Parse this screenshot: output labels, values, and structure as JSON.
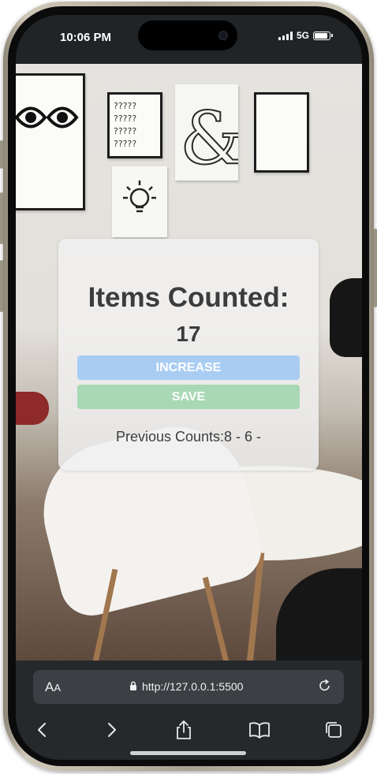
{
  "status_bar": {
    "time": "10:06 PM",
    "network": "5G"
  },
  "app": {
    "title": "Items Counted:",
    "count": "17",
    "increase_label": "INCREASE",
    "save_label": "SAVE",
    "previous_counts": "Previous Counts:8 - 6 -"
  },
  "browser": {
    "text_size_label": "A",
    "text_size_small": "A",
    "url": "http://127.0.0.1:5500"
  },
  "colors": {
    "increase_button": "#a9ccf2",
    "save_button": "#a9d8b4",
    "text": "#3c3c3c",
    "browser_chrome": "#26292c"
  },
  "icons": [
    "lock-icon",
    "reload-icon",
    "back-icon",
    "forward-icon",
    "share-icon",
    "bookmarks-icon",
    "tabs-icon"
  ]
}
